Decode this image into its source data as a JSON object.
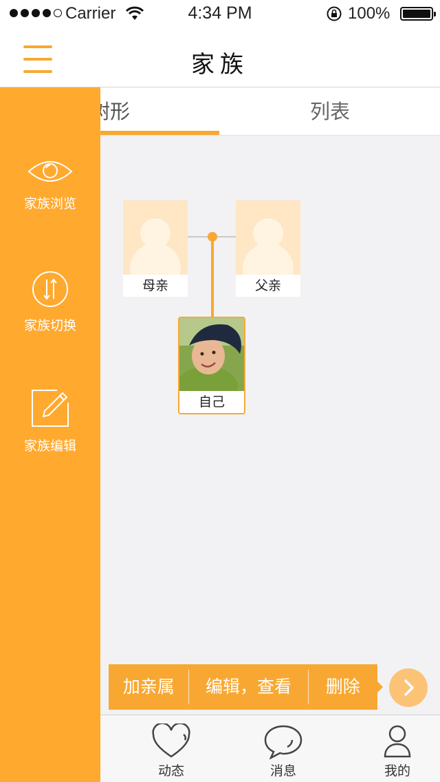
{
  "status_bar": {
    "carrier": "Carrier",
    "time": "4:34 PM",
    "battery": "100%"
  },
  "nav": {
    "title": "家族"
  },
  "tabs": [
    {
      "label": "树形",
      "selected": true
    },
    {
      "label": "列表",
      "selected": false
    }
  ],
  "tree": {
    "mother": "母亲",
    "father": "父亲",
    "self": "自己"
  },
  "actions": {
    "add": "加亲属",
    "edit_view": "编辑，查看",
    "delete": "删除"
  },
  "bottom_tabs": [
    {
      "label": "动态",
      "icon": "heart-icon"
    },
    {
      "label": "消息",
      "icon": "chat-bubble-icon"
    },
    {
      "label": "我的",
      "icon": "person-icon"
    }
  ],
  "drawer": [
    {
      "label": "家族浏览",
      "icon": "eye-icon"
    },
    {
      "label": "家族切换",
      "icon": "switch-arrows-icon"
    },
    {
      "label": "家族编辑",
      "icon": "edit-pencil-icon"
    }
  ],
  "colors": {
    "accent": "#f8a832",
    "drawer": "#ffa92f",
    "placeholder": "#ffe6c4"
  }
}
